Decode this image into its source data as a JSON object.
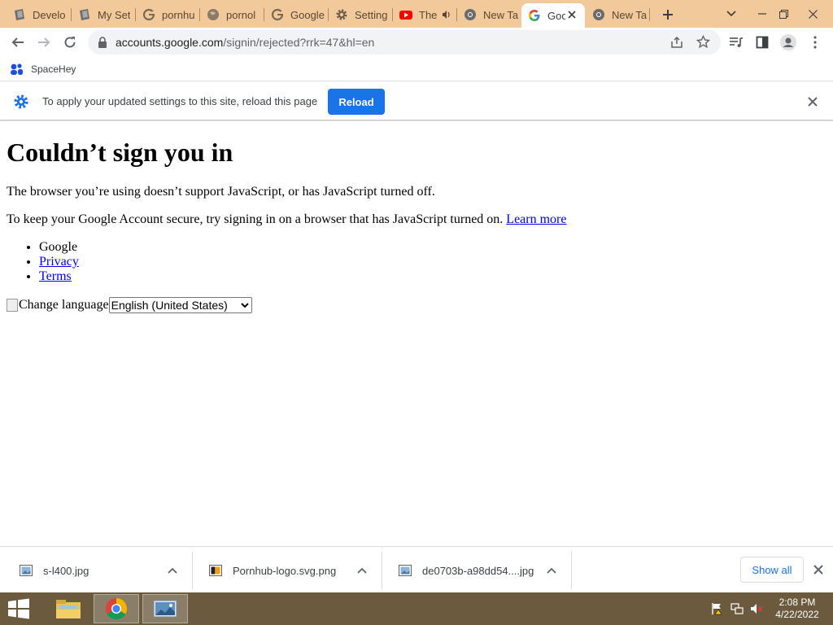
{
  "tabs": [
    {
      "label": "Develo",
      "icon": "page-icon"
    },
    {
      "label": "My Set",
      "icon": "page-icon"
    },
    {
      "label": "pornhu",
      "icon": "google-g-icon"
    },
    {
      "label": "pornol",
      "icon": "globe-icon"
    },
    {
      "label": "Google",
      "icon": "google-g-icon"
    },
    {
      "label": "Setting",
      "icon": "gear-icon"
    },
    {
      "label": "The",
      "icon": "youtube-icon",
      "audio": true
    },
    {
      "label": "New Ta",
      "icon": "chrome-icon"
    },
    {
      "label": "Goc",
      "icon": "google-g-icon",
      "active": true
    },
    {
      "label": "New Ta",
      "icon": "chrome-icon"
    }
  ],
  "toolbar": {
    "url_host": "accounts.google.com",
    "url_rest": "/signin/rejected?rrk=47&hl=en"
  },
  "bookmarks": [
    {
      "label": "SpaceHey",
      "icon": "spacehey-icon"
    }
  ],
  "infobar": {
    "message": "To apply your updated settings to this site, reload this page",
    "reload_label": "Reload"
  },
  "page": {
    "heading": "Couldn’t sign you in",
    "para1": "The browser you’re using doesn’t support JavaScript, or has JavaScript turned off.",
    "para2": "To keep your Google Account secure, try signing in on a browser that has JavaScript turned on.",
    "learn_more": "Learn more",
    "footer_links": [
      "Google",
      "Privacy",
      "Terms"
    ],
    "change_language_alt": "Change language",
    "language_selected": "English (United States)"
  },
  "downloads": {
    "items": [
      {
        "name": "s-l400.jpg"
      },
      {
        "name": "Pornhub-logo.svg.png"
      },
      {
        "name": "de0703b-a98dd54....jpg"
      }
    ],
    "show_all_label": "Show all"
  },
  "taskbar": {
    "time": "2:08 PM",
    "date": "4/22/2022"
  },
  "colors": {
    "tabstrip": "#f2c99a",
    "accent": "#1a73e8",
    "taskbar": "#6b5a3e",
    "link": "#0000ee"
  }
}
